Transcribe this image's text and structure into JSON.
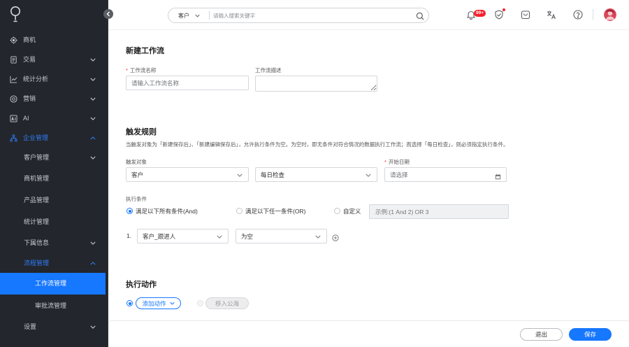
{
  "sidebar": {
    "logo": "pin-logo-icon",
    "items": [
      {
        "label": "商机",
        "icon": "target-icon"
      },
      {
        "label": "交易",
        "icon": "document-icon"
      },
      {
        "label": "统计分析",
        "icon": "line-chart-icon"
      },
      {
        "label": "营销",
        "icon": "bullseye-icon"
      },
      {
        "label": "AI",
        "icon": "ai-icon"
      },
      {
        "label": "企业管理",
        "icon": "org-chart-icon"
      },
      {
        "label": "客户管理"
      },
      {
        "label": "商机管理"
      },
      {
        "label": "产品管理"
      },
      {
        "label": "统计管理"
      },
      {
        "label": "下属信息"
      },
      {
        "label": "流程管理"
      },
      {
        "label": "工作流管理"
      },
      {
        "label": "审批流管理"
      },
      {
        "label": "设置"
      }
    ]
  },
  "header": {
    "search": {
      "scope": "客户",
      "placeholder": "请输入搜索关键字"
    },
    "notification_count": "99+",
    "icons": [
      "bell-icon",
      "shield-check-icon",
      "bag-icon",
      "translate-icon",
      "help-icon",
      "avatar"
    ]
  },
  "form": {
    "title": "新建工作流",
    "name": {
      "required_mark": "*",
      "label": "工作流名称",
      "placeholder": "请输入工作流名称"
    },
    "description": {
      "label": "工作流描述"
    }
  },
  "trigger": {
    "title": "触发规则",
    "hint": "当触发对象为「新建保存后」、「新建编辑保存后」，允许执行条件为空。为空时，即无条件对符合情况的数据执行工作流；而选择「每日检查」，则必须指定执行条件。",
    "object_label": "触发对象",
    "object_value": "客户",
    "timing_value": "每日检查",
    "start_date": {
      "required_mark": "*",
      "label": "开始日期",
      "placeholder": "请选择"
    }
  },
  "conditions": {
    "label": "执行条件",
    "options": [
      "满足以下所有条件(And)",
      "满足以下任一条件(OR)",
      "自定义"
    ],
    "selected_index": 0,
    "custom_placeholder": "示例:(1 And 2) OR 3",
    "rows": [
      {
        "index": "1.",
        "field": "客户_跟进人",
        "operator": "为空"
      }
    ]
  },
  "actions": {
    "title": "执行动作",
    "add_label": "添加动作",
    "move_label": "移入公海"
  },
  "footer": {
    "exit_label": "退出",
    "save_label": "保存"
  },
  "colors": {
    "accent": "#1677ff",
    "sidebar_bg": "#23262c",
    "danger": "#f5222d"
  }
}
